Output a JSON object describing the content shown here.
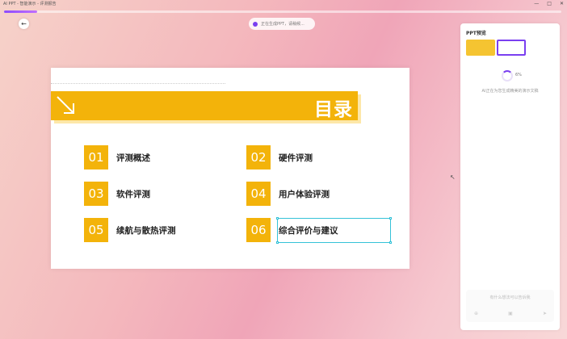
{
  "window": {
    "title": "AI PPT - 智能演示 - 评测报告",
    "controls": [
      "—",
      "□",
      "✕"
    ]
  },
  "progress": {
    "fraction": 0.06,
    "color": "#8d4bff"
  },
  "status_pill": {
    "text": "正在生成PPT，请稍候..."
  },
  "slide": {
    "title": "目录",
    "accent_color": "#f3b30a",
    "items": [
      {
        "num": "01",
        "label": "评测概述"
      },
      {
        "num": "02",
        "label": "硬件评测"
      },
      {
        "num": "03",
        "label": "软件评测"
      },
      {
        "num": "04",
        "label": "用户体验评测"
      },
      {
        "num": "05",
        "label": "续航与散热评测"
      },
      {
        "num": "06",
        "label": "综合评价与建议"
      }
    ]
  },
  "panel": {
    "title": "PPT预览",
    "progress_text": "6%",
    "message": "AI正在为您生成精美的演示文稿",
    "input_placeholder": "有什么想法可以告诉我",
    "icons": [
      "attach-icon",
      "image-icon",
      "send-icon"
    ]
  }
}
